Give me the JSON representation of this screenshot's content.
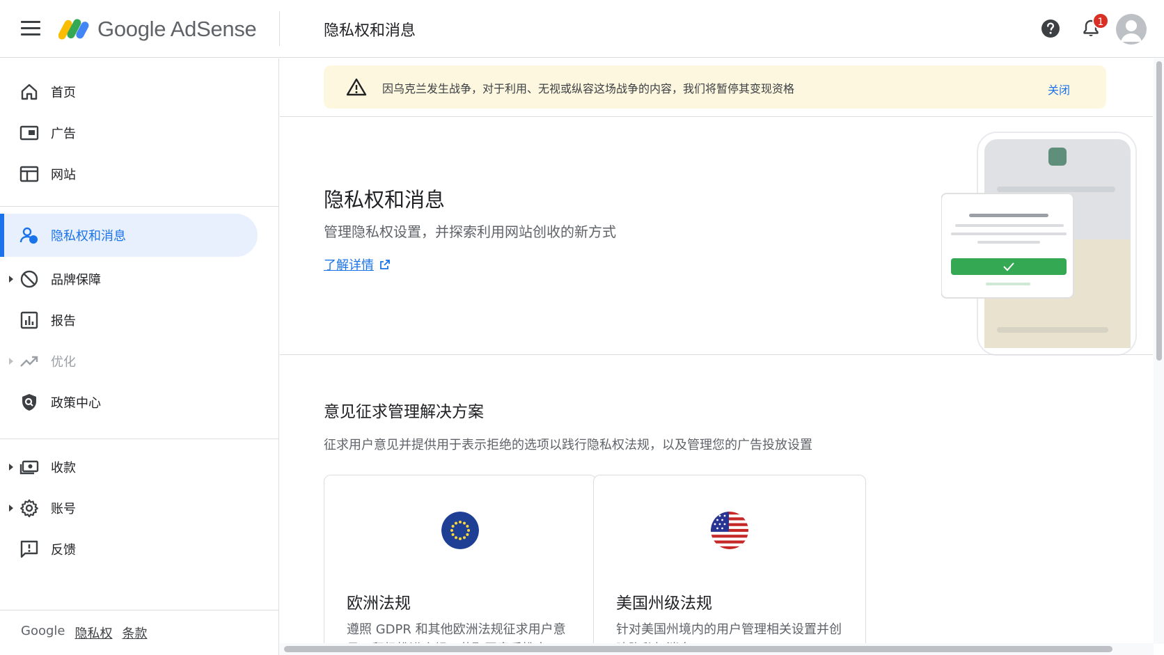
{
  "header": {
    "app_name": "Google AdSense",
    "page_title": "隐私权和消息",
    "notification_count": "1"
  },
  "sidebar": {
    "items": [
      {
        "label": "首页",
        "icon": "home-icon"
      },
      {
        "label": "广告",
        "icon": "ads-icon"
      },
      {
        "label": "网站",
        "icon": "sites-icon"
      },
      {
        "label": "隐私权和消息",
        "icon": "privacy-icon",
        "active": true
      },
      {
        "label": "品牌保障",
        "icon": "block-icon",
        "expandable": true
      },
      {
        "label": "报告",
        "icon": "reports-icon"
      },
      {
        "label": "优化",
        "icon": "trending-icon",
        "expandable": true,
        "disabled": true
      },
      {
        "label": "政策中心",
        "icon": "policy-icon"
      },
      {
        "label": "收款",
        "icon": "payments-icon",
        "expandable": true
      },
      {
        "label": "账号",
        "icon": "settings-icon",
        "expandable": true
      },
      {
        "label": "反馈",
        "icon": "feedback-icon"
      }
    ],
    "footer": {
      "brand": "Google",
      "privacy": "隐私权",
      "terms": "条款"
    }
  },
  "banner": {
    "text": "因乌克兰发生战争，对于利用、无视或纵容这场战争的内容，我们将暂停其变现资格",
    "close_label": "关闭"
  },
  "hero": {
    "title": "隐私权和消息",
    "subtitle": "管理隐私权设置，并探索利用网站创收的新方式",
    "learn_more": "了解详情"
  },
  "consent": {
    "title": "意见征求管理解决方案",
    "subtitle": "征求用户意见并提供用于表示拒绝的选项以践行隐私权法规，以及管理您的广告投放设置",
    "cards": [
      {
        "title": "欧洲法规",
        "description": "遵照 GDPR 和其他欧洲法规征求用户意见，积极推进合规…获取同意后推出"
      },
      {
        "title": "美国州级法规",
        "description": "针对美国州境内的用户管理相关设置并创建隐私权消息"
      }
    ]
  },
  "colors": {
    "accent": "#1a73e8",
    "banner_bg": "#fef7e0",
    "active_bg": "#e8f0fe",
    "badge": "#d93025"
  }
}
